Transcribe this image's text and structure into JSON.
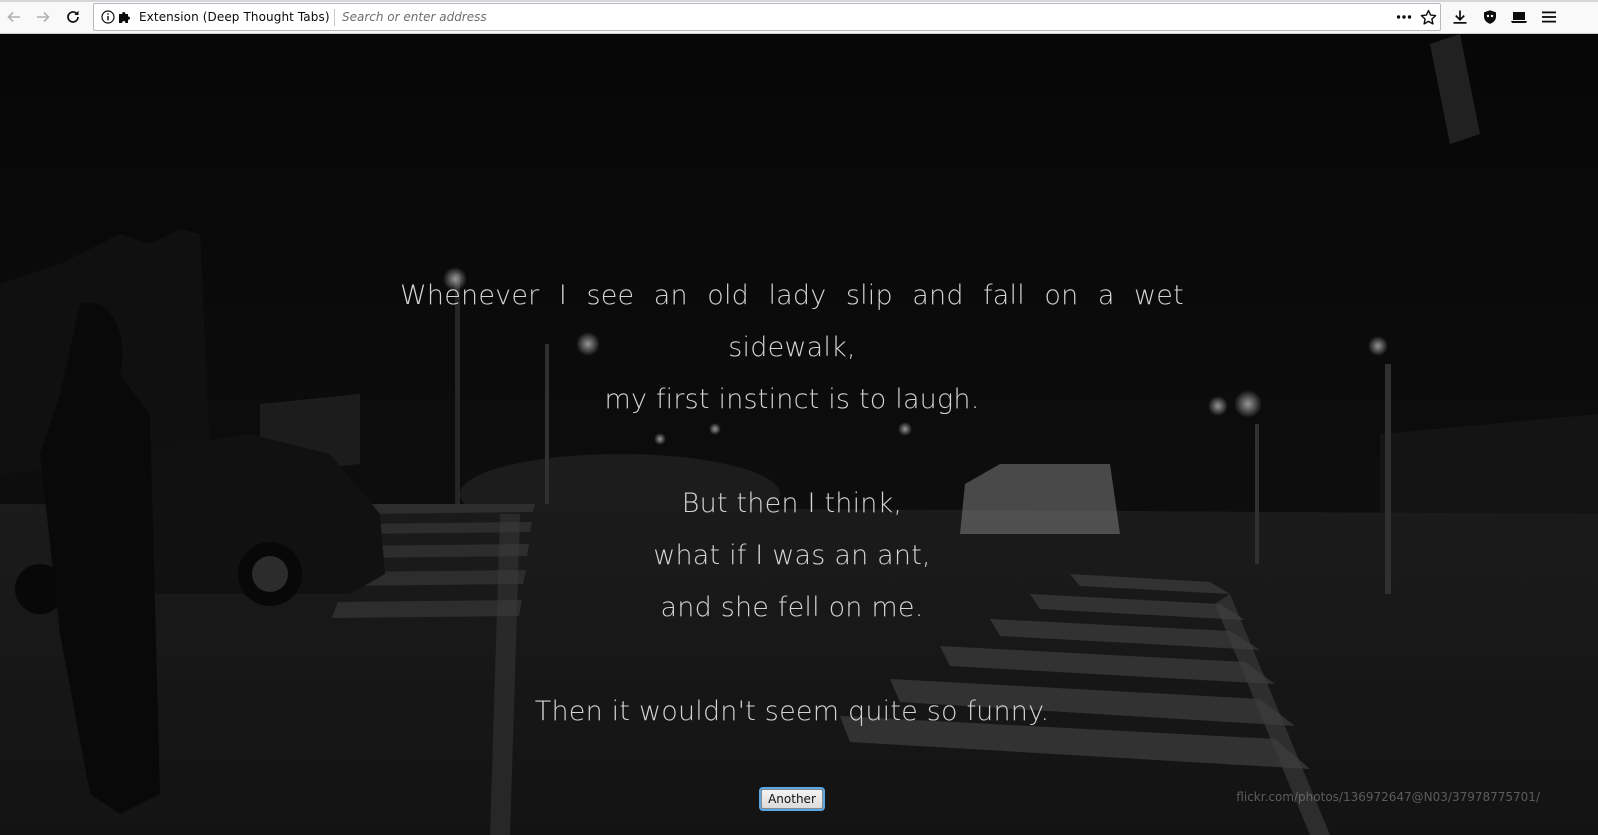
{
  "browser": {
    "identity_label": "Extension (Deep Thought Tabs)",
    "address_placeholder": "Search or enter address",
    "address_value": ""
  },
  "quote": {
    "line1_words": [
      "Whenever",
      "I",
      "see",
      "an",
      "old",
      "lady",
      "slip",
      "and",
      "fall",
      "on",
      "a",
      "wet"
    ],
    "line2": "sidewalk,",
    "line3": "my first instinct is to laugh.",
    "line4": "But then I think,",
    "line5": "what if I was an ant,",
    "line6": "and she fell on me.",
    "line7": "Then it wouldn't seem quite so funny."
  },
  "controls": {
    "another_label": "Another"
  },
  "photo_credit": "flickr.com/photos/136972647@N03/37978775701/",
  "colors": {
    "quote_text": "#d4d4d4",
    "background": "#0d0d0d",
    "toolbar": "#f9f9fa",
    "focus_ring": "#5aa7e6"
  }
}
